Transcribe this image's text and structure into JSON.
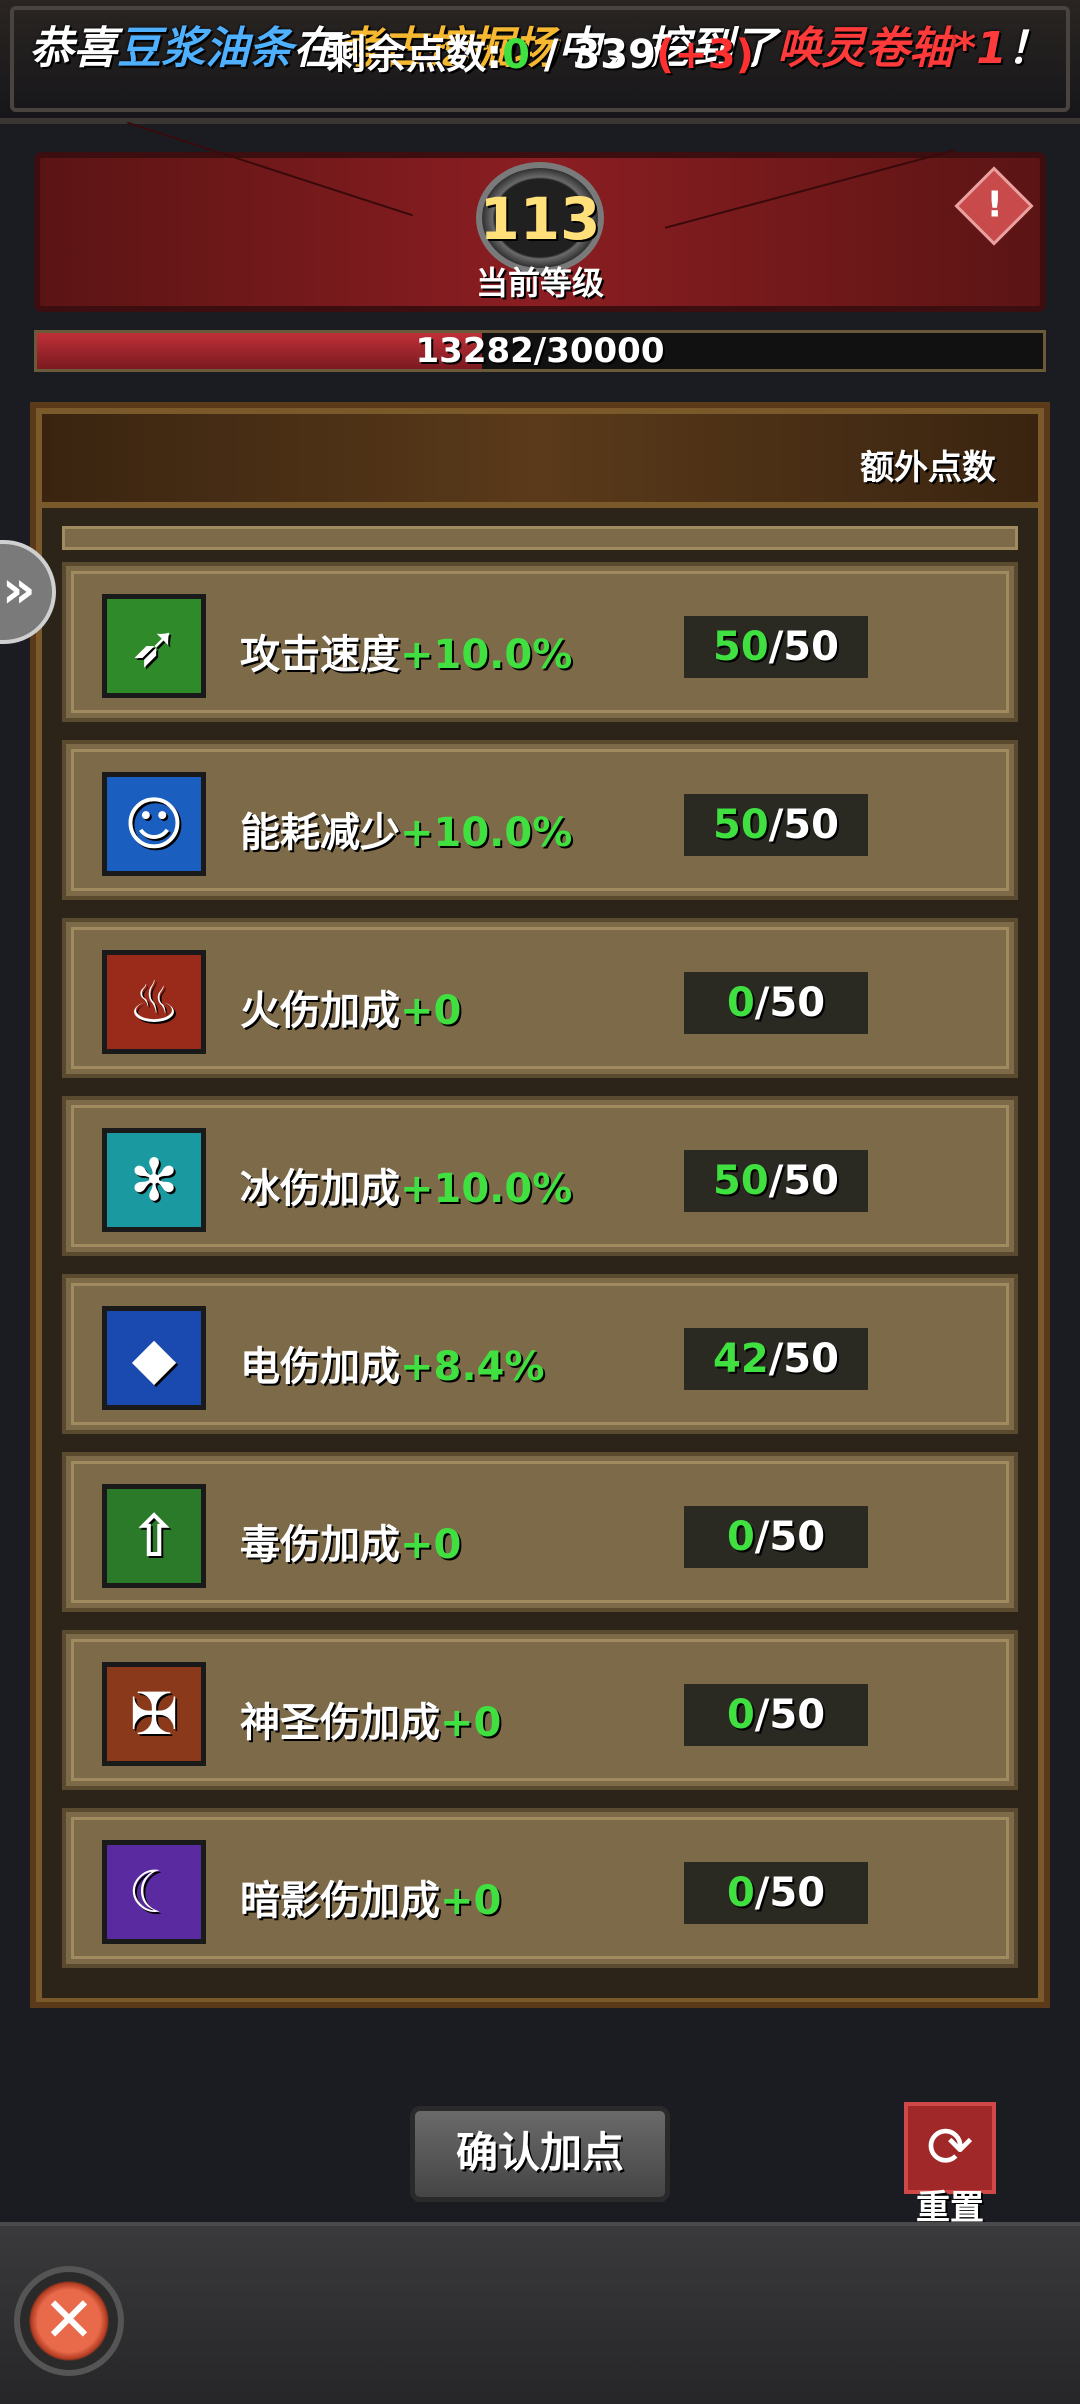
{
  "banner": {
    "parts": [
      {
        "text": "恭喜",
        "color": "#ffffff"
      },
      {
        "text": "豆浆油条",
        "color": "#4fb0ff"
      },
      {
        "text": "在",
        "color": "#ffffff"
      },
      {
        "text": "考古挖掘场",
        "color": "#f5b830"
      },
      {
        "text": "中，挖到了",
        "color": "#ffffff"
      },
      {
        "text": "唤灵卷轴",
        "color": "#ff3a3a"
      },
      {
        "text": "*1",
        "color": "#ff3a3a"
      },
      {
        "text": "！",
        "color": "#ffffff"
      }
    ]
  },
  "level": {
    "number": "113",
    "label": "当前等级",
    "xp_text": "13282/30000",
    "xp_progress": 0.4427
  },
  "points": {
    "label": "剩余点数:",
    "remaining": "0",
    "separator": " / ",
    "total": "339",
    "bonus": "(+3)",
    "extra_label": "额外点数"
  },
  "stats": [
    {
      "name": "攻击速度",
      "bonus": "+10.0%",
      "current": "50",
      "max": "/50",
      "icon": "attack-speed-icon",
      "icon_bg": "#2f8a2a",
      "icon_glyph": "➶"
    },
    {
      "name": "能耗减少",
      "bonus": "+10.0%",
      "current": "50",
      "max": "/50",
      "icon": "energy-reduction-icon",
      "icon_bg": "#1a5ec0",
      "icon_glyph": "☺"
    },
    {
      "name": "火伤加成",
      "bonus": "+0",
      "current": "0",
      "max": "/50",
      "icon": "fire-damage-icon",
      "icon_bg": "#9a2a1a",
      "icon_glyph": "♨"
    },
    {
      "name": "冰伤加成",
      "bonus": "+10.0%",
      "current": "50",
      "max": "/50",
      "icon": "ice-damage-icon",
      "icon_bg": "#1a9aa0",
      "icon_glyph": "✻"
    },
    {
      "name": "电伤加成",
      "bonus": "+8.4%",
      "current": "42",
      "max": "/50",
      "icon": "electric-damage-icon",
      "icon_bg": "#1a4ab0",
      "icon_glyph": "◆"
    },
    {
      "name": "毒伤加成",
      "bonus": "+0",
      "current": "0",
      "max": "/50",
      "icon": "poison-damage-icon",
      "icon_bg": "#2a7a2a",
      "icon_glyph": "⇧"
    },
    {
      "name": "神圣伤加成",
      "bonus": "+0",
      "current": "0",
      "max": "/50",
      "icon": "holy-damage-icon",
      "icon_bg": "#8a3a1a",
      "icon_glyph": "✠"
    },
    {
      "name": "暗影伤加成",
      "bonus": "+0",
      "current": "0",
      "max": "/50",
      "icon": "shadow-damage-icon",
      "icon_bg": "#5a2aa0",
      "icon_glyph": "☾"
    }
  ],
  "buttons": {
    "confirm": "确认加点",
    "reset": "重置"
  },
  "icons": {
    "warning": "!",
    "side_tab": "»",
    "reset": "⟳",
    "close": "✕"
  }
}
